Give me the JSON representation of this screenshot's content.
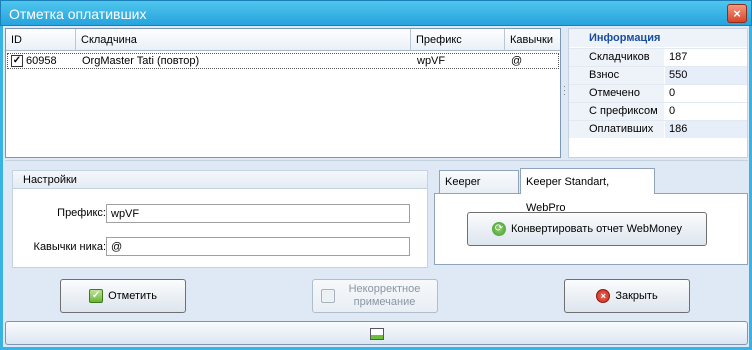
{
  "window": {
    "title": "Отметка оплативших",
    "close_glyph": "×"
  },
  "grid": {
    "columns": [
      "ID",
      "Складчина",
      "Префикс",
      "Кавычки"
    ],
    "rows": [
      {
        "checked": true,
        "id": "60958",
        "name": "OrgMaster Tati (повтор)",
        "prefix": "wpVF",
        "quote": "@"
      }
    ]
  },
  "info": {
    "title": "Информация",
    "rows": [
      {
        "key": "Складчиков",
        "value": "187"
      },
      {
        "key": "Взнос",
        "value": "550"
      },
      {
        "key": "Отмечено",
        "value": "0"
      },
      {
        "key": "С префиксом",
        "value": "0"
      },
      {
        "key": "Оплативших",
        "value": "186"
      }
    ]
  },
  "settings": {
    "title": "Настройки",
    "prefix_label": "Префикс:",
    "prefix_value": "wpVF",
    "quote_label": "Кавычки ника:",
    "quote_value": "@"
  },
  "tabs": {
    "items": [
      "Keeper WinPro",
      "Keeper Standart, WebPro"
    ],
    "active": 1,
    "convert_button": "Конвертировать отчет WebMoney"
  },
  "buttons": {
    "mark": "Отметить",
    "incorrect_note": "Некорректное примечание",
    "close": "Закрыть"
  },
  "icons": {
    "check": "check-icon",
    "note": "note-icon",
    "close": "close-circle-icon",
    "convert": "convert-icon",
    "panel": "panel-toggle-icon"
  },
  "colors": {
    "titlebar": "#27a3dd",
    "frame": "#3bb2e4",
    "info_title": "#1a4e9a"
  }
}
